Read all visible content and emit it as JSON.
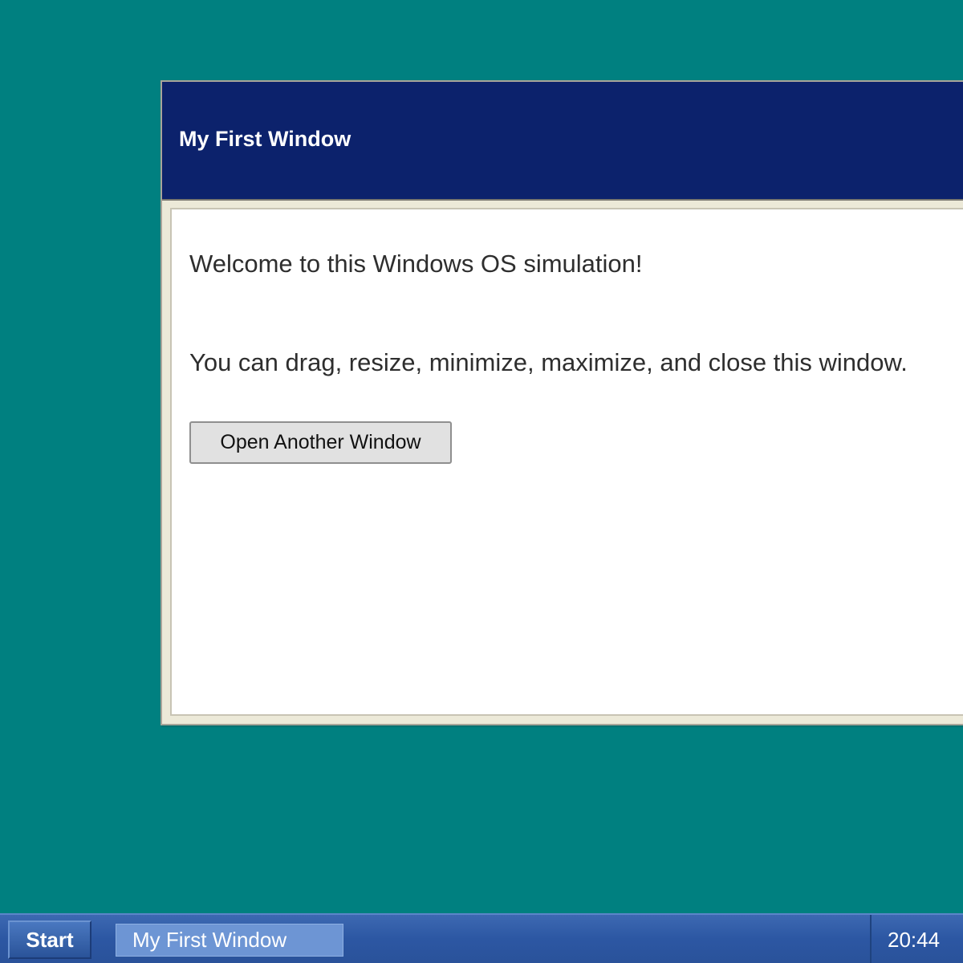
{
  "window": {
    "title": "My First Window",
    "welcome_text": "Welcome to this Windows OS simulation!",
    "instructions_text": "You can drag, resize, minimize, maximize, and close this window.",
    "open_button_label": "Open Another Window"
  },
  "taskbar": {
    "start_label": "Start",
    "items": [
      {
        "label": "My First Window"
      }
    ],
    "clock": "20:44"
  },
  "colors": {
    "desktop": "#008080",
    "titlebar": "#0c226c",
    "taskbar": "#2c57a3",
    "task_item_active": "#6d95d4"
  }
}
